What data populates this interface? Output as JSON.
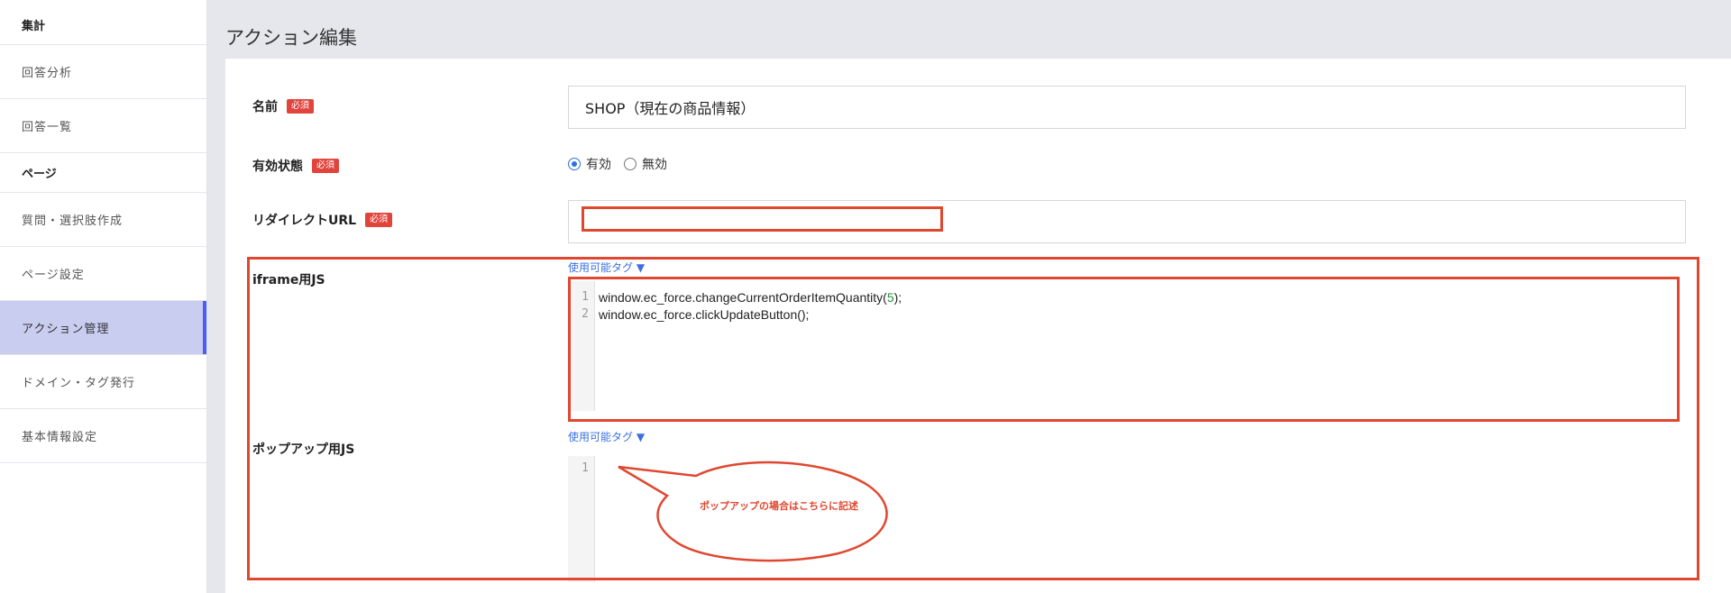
{
  "sidebar": {
    "section_1": "集計",
    "item_answer_analysis": "回答分析",
    "item_answer_list": "回答一覧",
    "section_2": "ページ",
    "item_question_create": "質問・選択肢作成",
    "item_page_settings": "ページ設定",
    "item_action_management": "アクション管理",
    "item_domain_tag": "ドメイン・タグ発行",
    "item_basic_info": "基本情報設定"
  },
  "page": {
    "title": "アクション編集"
  },
  "form": {
    "required_badge": "必須",
    "name_label": "名前",
    "name_value": "SHOP（現在の商品情報）",
    "status_label": "有効状態",
    "status_option_on": "有効",
    "status_option_off": "無効",
    "redirect_label": "リダイレクトURL",
    "redirect_value": "",
    "iframe_js_label": "iframe用JS",
    "popup_js_label": "ポップアップ用JS",
    "available_tags_link": "使用可能タグ ▼"
  },
  "iframe_editor": {
    "line_1_no": "1",
    "line_2_no": "2",
    "line_1_prefix": "window.ec_force.changeCurrentOrderItemQuantity(",
    "line_1_number": "5",
    "line_1_suffix": ");",
    "line_2": "window.ec_force.clickUpdateButton();"
  },
  "popup_editor": {
    "line_1_no": "1"
  },
  "annotation": {
    "bubble_text": "ポップアップの場合はこちらに記述",
    "color": "#e0472f"
  },
  "colors": {
    "accent": "#4a5ff0",
    "active_bg": "#c9cdf0",
    "required": "#e0443c",
    "link": "#3d6fe0"
  }
}
